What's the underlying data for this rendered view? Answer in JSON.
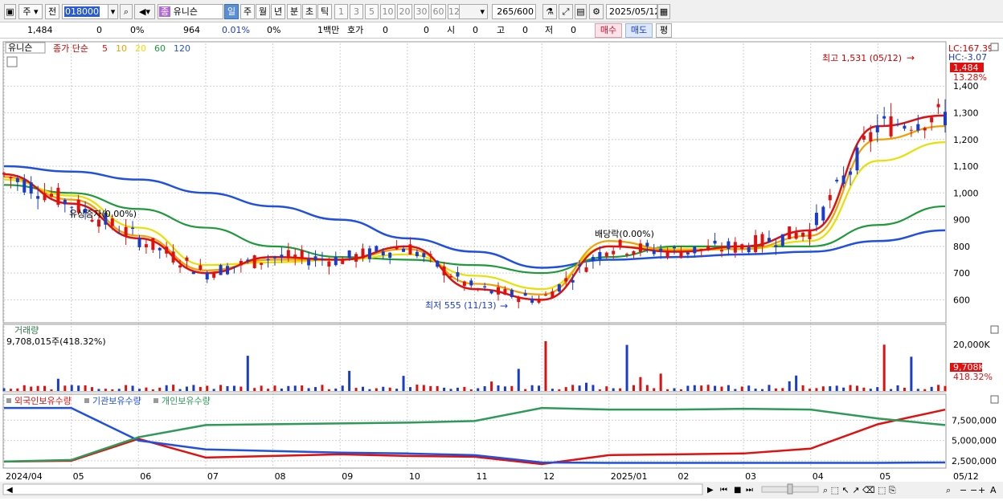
{
  "toolbar": {
    "period_type": "주",
    "prev_label": "전",
    "stock_code": "018000",
    "stock_badge": "종",
    "stock_name": "유니슨",
    "periods": [
      "일",
      "주",
      "월",
      "년",
      "분",
      "초",
      "틱"
    ],
    "selected_period": "일",
    "intervals": [
      "1",
      "3",
      "5",
      "10",
      "20",
      "30",
      "60",
      "120"
    ],
    "count": "265",
    "count_total": "/600",
    "date": "2025/05/12"
  },
  "info": {
    "price": "1,484",
    "change": "0",
    "change_pct": "0%",
    "volume": "964",
    "vol_pct": "0.01%",
    "pct2": "0%",
    "unit": "1백만",
    "hoga_label": "호가",
    "hoga_v1": "0",
    "hoga_v2": "0",
    "open_label": "시",
    "open_val": "0",
    "high_label": "고",
    "high_val": "0",
    "low_label": "저",
    "low_val": "0",
    "buy_label": "매수",
    "sell_label": "매도",
    "eval_label": "평"
  },
  "price_panel": {
    "stock_tag": "유니슨",
    "legend_prefix": "종가 단순",
    "ma_periods": [
      "5",
      "10",
      "20",
      "60",
      "120"
    ],
    "ma_colors": [
      "#e01010",
      "#f0a000",
      "#e8e000",
      "#1e9a3a",
      "#2050e0"
    ],
    "lc": "LC:167.39",
    "hc": "HC:-3.07",
    "current_price": "1,484",
    "current_pct": "13.28%",
    "high_annotation": "최고 1,531 (05/12)",
    "low_annotation": "최저 555 (11/13)",
    "event1": "유상증자(0.00%)",
    "event2": "배당락(0.00%)",
    "y_ticks": [
      "1,400",
      "1,300",
      "1,200",
      "1,100",
      "1,000",
      "900",
      "800",
      "700",
      "600"
    ]
  },
  "volume_panel": {
    "title": "거래량",
    "value_text": "9,708,015주(418.32%)",
    "tick": "20,000K",
    "current": "9,708K",
    "current_pct": "418.32%"
  },
  "holdings_panel": {
    "legend": [
      "외국인보유수량",
      "기관보유수량",
      "개인보유수량"
    ],
    "colors": [
      "#e01010",
      "#2050e0",
      "#2e9a5a"
    ],
    "ticks": [
      "7,500,000",
      "5,000,000",
      "2,500,000"
    ]
  },
  "x_axis": {
    "labels": [
      "2024/04",
      "05",
      "06",
      "07",
      "08",
      "09",
      "10",
      "11",
      "12",
      "2025/01",
      "02",
      "03",
      "04",
      "05",
      "05/12"
    ]
  },
  "chart_data": [
    {
      "type": "line",
      "title": "유니슨 종가 단순 이동평균",
      "x": [
        "2024/04",
        "05",
        "06",
        "07",
        "08",
        "09",
        "10",
        "11",
        "12",
        "2025/01",
        "02",
        "03",
        "04",
        "05",
        "05/12"
      ],
      "series": [
        {
          "name": "5",
          "values": [
            1070,
            960,
            830,
            700,
            760,
            750,
            800,
            640,
            600,
            800,
            780,
            800,
            860,
            1250,
            1290
          ]
        },
        {
          "name": "10",
          "values": [
            1060,
            975,
            840,
            710,
            750,
            750,
            790,
            660,
            620,
            820,
            785,
            790,
            840,
            1200,
            1250
          ]
        },
        {
          "name": "20",
          "values": [
            1050,
            990,
            870,
            730,
            740,
            750,
            770,
            690,
            640,
            800,
            790,
            790,
            820,
            1120,
            1190
          ]
        },
        {
          "name": "60",
          "values": [
            1030,
            1000,
            940,
            870,
            800,
            760,
            750,
            730,
            700,
            760,
            800,
            800,
            800,
            880,
            950
          ]
        },
        {
          "name": "120",
          "values": [
            1100,
            1080,
            1050,
            1000,
            950,
            900,
            830,
            780,
            720,
            750,
            760,
            770,
            780,
            820,
            860
          ]
        }
      ],
      "ylim": [
        520,
        1560
      ],
      "high": 1531,
      "low": 555
    },
    {
      "type": "line",
      "title": "보유수량",
      "x": [
        "2024/04",
        "05",
        "06",
        "07",
        "08",
        "09",
        "10",
        "11",
        "12",
        "2025/01",
        "02",
        "03",
        "04",
        "05",
        "05/12"
      ],
      "series": [
        {
          "name": "외국인보유수량",
          "values": [
            2400000,
            2500000,
            5200000,
            2900000,
            3100000,
            3300000,
            3100000,
            3000000,
            2100000,
            3200000,
            3300000,
            3400000,
            4000000,
            7000000,
            8800000
          ]
        },
        {
          "name": "기관보유수량",
          "values": [
            9000000,
            9000000,
            5000000,
            3900000,
            3700000,
            3500000,
            3400000,
            3200000,
            2300000,
            2250000,
            2250000,
            2250000,
            2250000,
            2250000,
            2300000
          ]
        },
        {
          "name": "개인보유수량",
          "values": [
            2400000,
            2600000,
            5400000,
            6900000,
            7000000,
            7100000,
            7200000,
            7400000,
            9000000,
            8800000,
            8800000,
            8900000,
            8800000,
            7700000,
            6900000
          ]
        }
      ],
      "ylim": [
        1800000,
        10200000
      ]
    }
  ]
}
